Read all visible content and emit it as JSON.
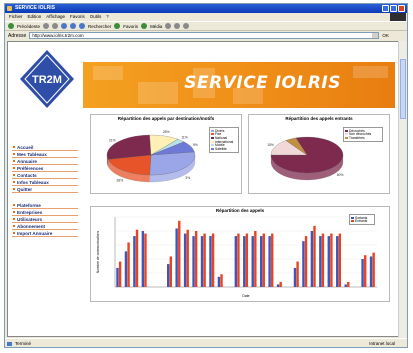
{
  "window": {
    "title": "SERVICE IOLRIS",
    "menu": [
      "Fichier",
      "Edition",
      "Affichage",
      "Favoris",
      "Outils",
      "?"
    ],
    "toolbar": {
      "back": "Précédente",
      "search": "Rechercher",
      "favorites": "Favoris",
      "media": "Média"
    },
    "address_label": "Adresse",
    "address_value": "http://www.iolris.tr2m.com",
    "go_label": "OK",
    "status_left": "Terminé",
    "status_zone": "Intranet local"
  },
  "header": {
    "logo_text": "TR2M",
    "banner_title": "SERVICE IOLRIS"
  },
  "nav": {
    "group1": [
      "Accueil",
      "Mes Tableaux",
      "Annuaire",
      "Préférences",
      "Contacts",
      "Infos Tableaux",
      "Quitter"
    ],
    "group2": [
      "Plateforme",
      "Entreprises",
      "Utilisateurs",
      "Abonnement",
      "Import Annuaire"
    ]
  },
  "colors": {
    "orange": "#f39a1c",
    "blue": "#233a8a",
    "pie1": "#9aa6e8",
    "pie2": "#e8542a",
    "pie3": "#7e2a4e",
    "pie4": "#fff0b8",
    "pie5": "#b8e2ea",
    "bar_blue": "#3f55b8",
    "bar_red": "#e9441f"
  },
  "chart_data": [
    {
      "type": "pie",
      "title": "Répartition des appels par destination/motifs",
      "labels": [
        "Divers",
        "Fixe",
        "National",
        "International",
        "Mobile",
        "Satellite"
      ],
      "values": [
        28,
        21,
        28,
        11,
        3,
        9
      ],
      "slice_labels": [
        "3%",
        "28%",
        "21%",
        "28%",
        "11%",
        "9%"
      ]
    },
    {
      "type": "pie",
      "title": "Répartition des appels entrants",
      "labels": [
        "Décrochés",
        "Non décrochés",
        "Transférés"
      ],
      "values": [
        80,
        15,
        5
      ],
      "slice_labels": [
        "80%",
        "15%"
      ]
    },
    {
      "type": "bar",
      "title": "Répartition des appels",
      "ylabel": "Nombre de communications",
      "xlabel": "Date",
      "series": [
        {
          "name": "Sortants",
          "values": [
            15,
            28,
            40,
            44,
            0,
            0,
            18,
            46,
            42,
            40,
            40,
            40,
            8,
            0,
            40,
            40,
            40,
            40,
            40,
            2,
            0,
            15,
            36,
            44,
            40,
            40,
            40,
            2,
            0,
            22,
            24
          ]
        },
        {
          "name": "Entrants",
          "values": [
            20,
            35,
            45,
            42,
            0,
            0,
            24,
            52,
            45,
            44,
            42,
            42,
            10,
            0,
            42,
            42,
            44,
            42,
            42,
            4,
            0,
            20,
            40,
            48,
            42,
            42,
            42,
            4,
            0,
            25,
            27
          ]
        }
      ],
      "ylim": [
        0,
        55
      ]
    }
  ]
}
